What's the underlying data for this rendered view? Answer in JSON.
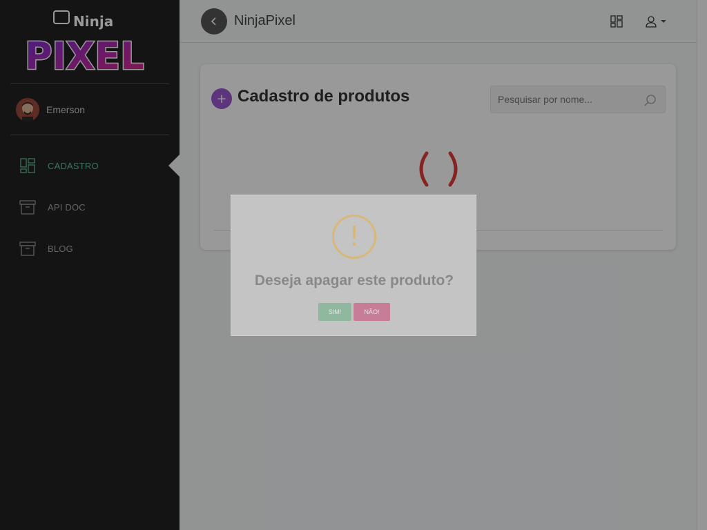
{
  "app": {
    "brand": "NinjaPixel",
    "logo_line1": "Ninja",
    "logo_line2": "PIXEL"
  },
  "user": {
    "name": "Emerson"
  },
  "sidebar": {
    "items": [
      {
        "label": "CADASTRO",
        "icon": "dashboard-icon",
        "active": true
      },
      {
        "label": "API DOC",
        "icon": "archive-icon",
        "active": false
      },
      {
        "label": "BLOG",
        "icon": "archive-icon",
        "active": false
      }
    ]
  },
  "topbar": {
    "back_icon": "chevron-left-icon",
    "grid_icon": "grid-icon",
    "user_icon": "user-icon"
  },
  "main": {
    "title": "Cadastro de produtos",
    "add_label": "+",
    "search": {
      "placeholder": "Pesquisar por nome..."
    }
  },
  "modal": {
    "icon_symbol": "!",
    "title": "Deseja apagar este produto?",
    "confirm_label": "SIM!",
    "cancel_label": "NÃO!"
  },
  "colors": {
    "accent_green": "#66c09a",
    "purple": "#9b59d0",
    "spinner_red": "#e03b3b",
    "warning": "#d8b87a"
  }
}
